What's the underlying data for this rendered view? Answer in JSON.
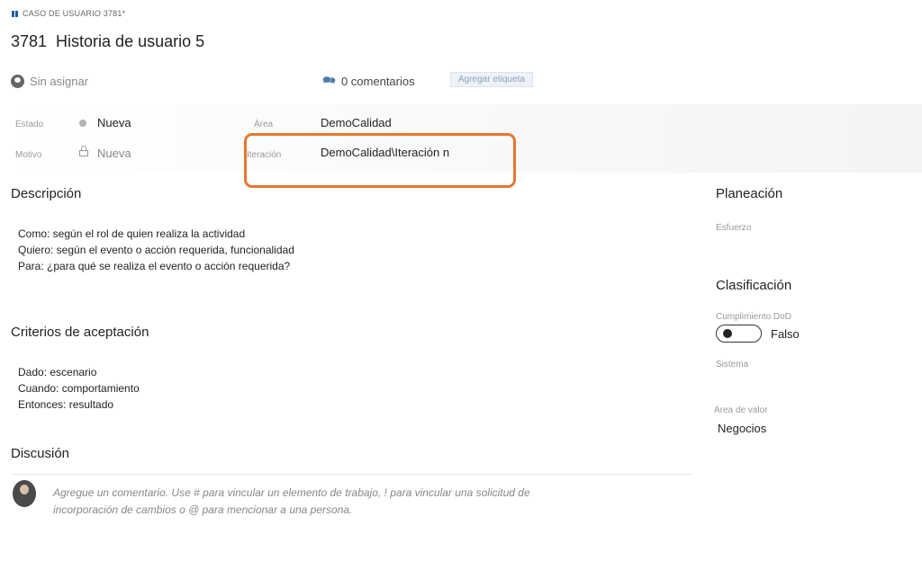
{
  "header": {
    "type_label": "CASO DE USUARIO 3781*",
    "id": "3781",
    "title": "Historia de usuario 5",
    "assigned": "Sin asignar",
    "comments": "0 comentarios",
    "add_tag": "Agregar etiqueta"
  },
  "fields": {
    "estado_label": "Estado",
    "estado_value": "Nueva",
    "motivo_label": "Motivo",
    "motivo_value": "Nueva",
    "area_label": "Área",
    "area_value": "DemoCalidad",
    "iteracion_label": "Iteración",
    "iteracion_value": "DemoCalidad\\Iteración n"
  },
  "descripcion": {
    "heading": "Descripción",
    "lines": [
      "Como: según el rol de quien realiza la actividad",
      "Quiero: según el evento o acción requerida, funcionalidad",
      "Para: ¿para qué se realiza el evento o acción requerida?"
    ]
  },
  "criterios": {
    "heading": "Criterios de aceptación",
    "lines": [
      "Dado: escenario",
      "Cuando: comportamiento",
      "Entonces: resultado"
    ]
  },
  "discusion": {
    "heading": "Discusión",
    "placeholder_line1": "Agregue un comentario. Use # para vincular un elemento de trabajo, ! para vincular una solicitud de",
    "placeholder_line2": "incorporación de cambios o @ para mencionar a una persona."
  },
  "sidebar": {
    "planeacion_heading": "Planeación",
    "esfuerzo_label": "Esfuerzo",
    "clasificacion_heading": "Clasificación",
    "dod_label": "Cumplimiento DoD",
    "dod_value": "Falso",
    "sistema_label": "Sistema",
    "area_valor_label": "Área de valor",
    "area_valor_value": "Negocios"
  },
  "colors": {
    "highlight": "#e6772e",
    "work_item_icon": "#1d5ea8"
  }
}
